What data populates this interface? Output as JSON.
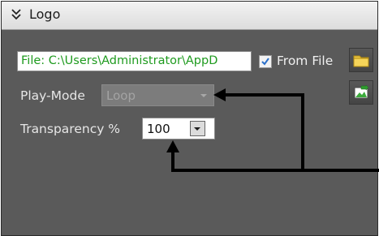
{
  "panel": {
    "title": "Logo",
    "collapse_icon": "double-chevron-down-icon"
  },
  "file": {
    "path_value": "File: C:\\Users\\Administrator\\AppD",
    "from_file_label": "From File",
    "from_file_checked": true,
    "browse_icon": "folder-icon",
    "open_icon": "image-open-icon"
  },
  "play_mode": {
    "label": "Play-Mode",
    "value": "Loop",
    "enabled": false
  },
  "transparency": {
    "label": "Transparency %",
    "value": "100"
  }
}
